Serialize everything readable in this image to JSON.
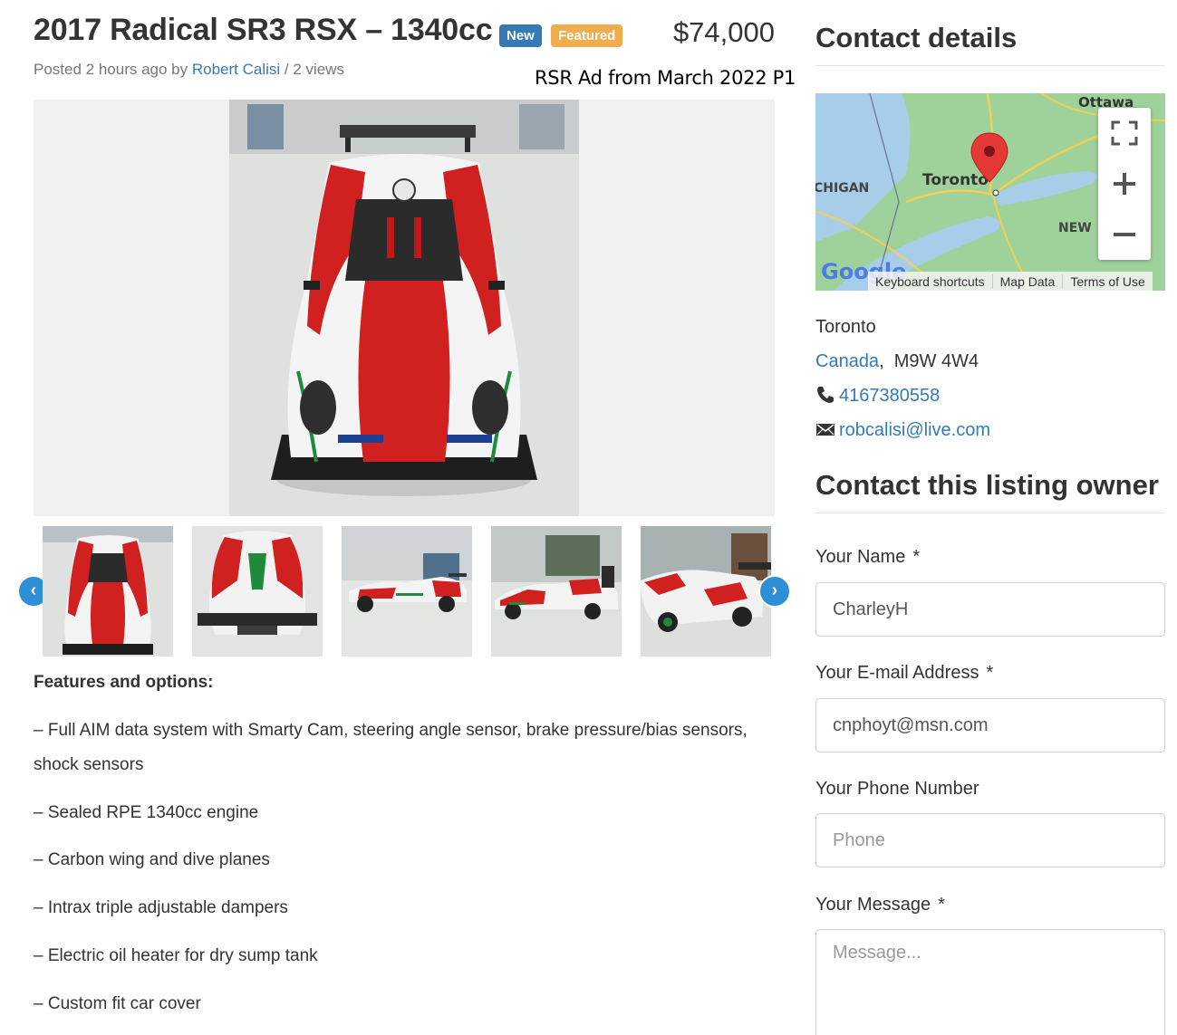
{
  "listing": {
    "title": "2017 Radical SR3 RSX – 1340cc",
    "badge_new": "New",
    "badge_featured": "Featured",
    "price": "$74,000",
    "meta_prefix": "Posted 2 hours ago by",
    "author": "Robert Calisi",
    "meta_suffix": "/ 2 views",
    "watermark": "RSR Ad from March 2022 P1"
  },
  "gallery": {
    "prev_label": "‹",
    "next_label": "›",
    "thumb_count": 5
  },
  "features": {
    "heading": "Features and options:",
    "items": [
      "– Full AIM data system with Smarty Cam, steering angle sensor, brake pressure/bias sensors, shock sensors",
      "– Sealed RPE 1340cc engine",
      "– Carbon wing and dive planes",
      "– Intrax triple adjustable dampers",
      "– Electric oil heater for dry sump tank",
      "– Custom fit car cover"
    ]
  },
  "contact": {
    "heading": "Contact details",
    "map": {
      "labels": [
        "Ottawa",
        "Toronto",
        "CHIGAN",
        "NEW",
        "Google"
      ],
      "footer": [
        "Keyboard shortcuts",
        "Map Data",
        "Terms of Use"
      ]
    },
    "city": "Toronto",
    "country": "Canada",
    "postal": "M9W 4W4",
    "phone": "4167380558",
    "email": "robcalisi@live.com"
  },
  "form": {
    "heading": "Contact this listing owner",
    "name_label": "Your Name",
    "name_value": "CharleyH",
    "email_label": "Your E-mail Address",
    "email_value": "cnphoyt@msn.com",
    "phone_label": "Your Phone Number",
    "phone_placeholder": "Phone",
    "message_label": "Your Message",
    "message_placeholder": "Message...",
    "required_mark": "*"
  },
  "colors": {
    "link": "#337ab7",
    "badge_new": "#337ab7",
    "badge_featured": "#f0ad4e",
    "carousel": "#2f8fd6",
    "car_red": "#d0201f",
    "car_green": "#1f8a3a"
  }
}
